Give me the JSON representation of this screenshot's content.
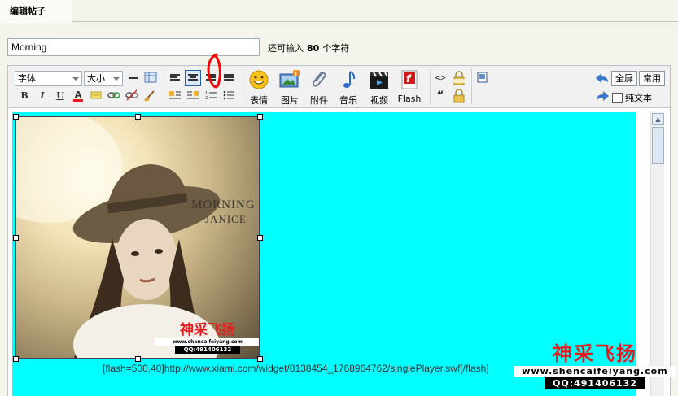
{
  "tab": {
    "label": "编辑帖子"
  },
  "title": {
    "value": "Morning"
  },
  "hint": {
    "prefix": "还可输入",
    "count": "80",
    "suffix": "个字符"
  },
  "toolbar": {
    "font_label": "字体",
    "size_label": "大小",
    "bold": "B",
    "italic": "I",
    "underline": "U",
    "color_letter": "A",
    "quote": "“",
    "media": [
      {
        "id": "emoticon",
        "label": "表情"
      },
      {
        "id": "image",
        "label": "图片"
      },
      {
        "id": "attach",
        "label": "附件"
      },
      {
        "id": "music",
        "label": "音乐"
      },
      {
        "id": "video",
        "label": "视频"
      },
      {
        "id": "flash",
        "label": "Flash"
      }
    ],
    "fullscreen": "全屏",
    "common": "常用",
    "plaintext": "纯文本"
  },
  "content": {
    "album_title": "MORNING",
    "album_artist": "JANICE",
    "flash_code": "[flash=500,40]http://www.xiami.com/widget/8138454_1768964762/singlePlayer.swf[/flash]"
  },
  "watermark": {
    "brand": "神采飞扬",
    "url": "www.shencaifeiyang.com",
    "qq": "QQ:491406132"
  },
  "colors": {
    "cyan": "#00ffff",
    "brand_red": "#e41e1e",
    "annotation_red": "#ff0000"
  }
}
